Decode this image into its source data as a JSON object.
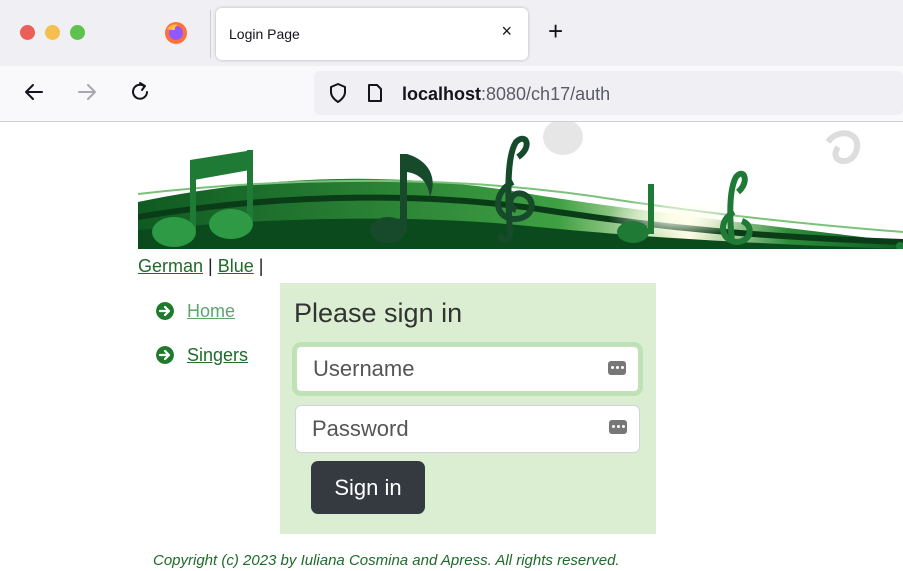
{
  "browser": {
    "tab_title": "Login Page",
    "tab_close": "×",
    "new_tab": "+",
    "url_host": "localhost",
    "url_rest": ":8080/ch17/auth"
  },
  "language_links": [
    {
      "label": "German"
    },
    {
      "label": "Blue"
    }
  ],
  "language_separator": "|",
  "sidebar": {
    "items": [
      {
        "label": "Home"
      },
      {
        "label": "Singers"
      }
    ]
  },
  "login": {
    "title": "Please sign in",
    "username_placeholder": "Username",
    "password_placeholder": "Password",
    "submit_label": "Sign in"
  },
  "footer": {
    "text": "Copyright (c) 2023 by Iuliana Cosmina and Apress. All rights reserved."
  },
  "colors": {
    "link_green": "#1e6b2a",
    "login_panel": "#dbeed2",
    "button_dark": "#343a40"
  }
}
